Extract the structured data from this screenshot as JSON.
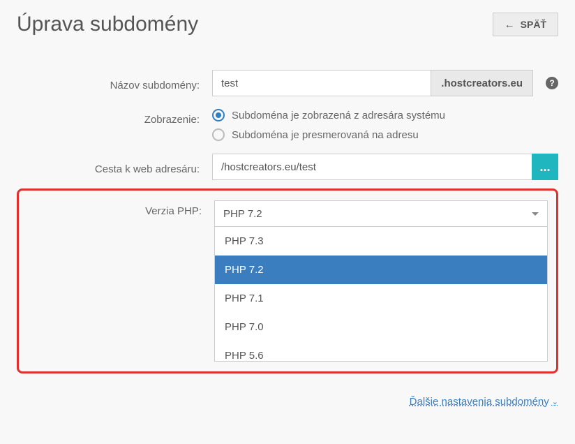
{
  "header": {
    "title": "Úprava subdomény",
    "back_label": "SPÄŤ"
  },
  "form": {
    "subdomain": {
      "label": "Názov subdomény:",
      "value": "test",
      "suffix": ".hostcreators.eu",
      "help": "?"
    },
    "display": {
      "label": "Zobrazenie:",
      "option_folder": "Subdoména je zobrazená z adresára systému",
      "option_redirect": "Subdoména je presmerovaná na adresu"
    },
    "path": {
      "label": "Cesta k web adresáru:",
      "value": "/hostcreators.eu/test",
      "browse": "..."
    },
    "php": {
      "label": "Verzia PHP:",
      "selected": "PHP 7.2",
      "options": [
        "PHP 7.3",
        "PHP 7.2",
        "PHP 7.1",
        "PHP 7.0",
        "PHP 5.6"
      ]
    }
  },
  "more_link": "Ďalšie nastavenia subdomény"
}
